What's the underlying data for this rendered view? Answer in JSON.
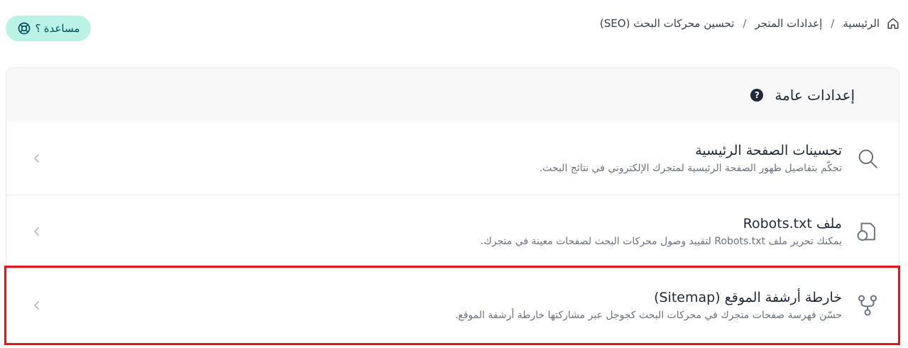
{
  "breadcrumb": {
    "home": "الرئيسية",
    "store_settings": "إعدادات المتجر",
    "current": "تحسين محركات البحث (SEO)",
    "separator": "/"
  },
  "help": {
    "label": "مساعدة ؟"
  },
  "section": {
    "title": "إعدادات عامة"
  },
  "rows": [
    {
      "title": "تحسينات الصفحة الرئيسية",
      "desc": "تحكّم بتفاصيل ظهور الصفحة الرئيسية لمتجرك الإلكتروني في نتائج البحث.",
      "icon": "search-icon"
    },
    {
      "title": "ملف Robots.txt",
      "desc": "يمكنك تحرير ملف Robots.txt لتقييد وصول محركات البحث لصفحات معينة في متجرك.",
      "icon": "file-shape-icon"
    },
    {
      "title": "خارطة أرشفة الموقع (Sitemap)",
      "desc": "حسّن فهرسة صفحات متجرك في محركات البحث كجوجل عبر مشاركتها خارطة أرشفة الموقع.",
      "icon": "git-fork-icon"
    }
  ],
  "colors": {
    "help_bg": "#baf3e6",
    "highlight": "#e0161e"
  }
}
